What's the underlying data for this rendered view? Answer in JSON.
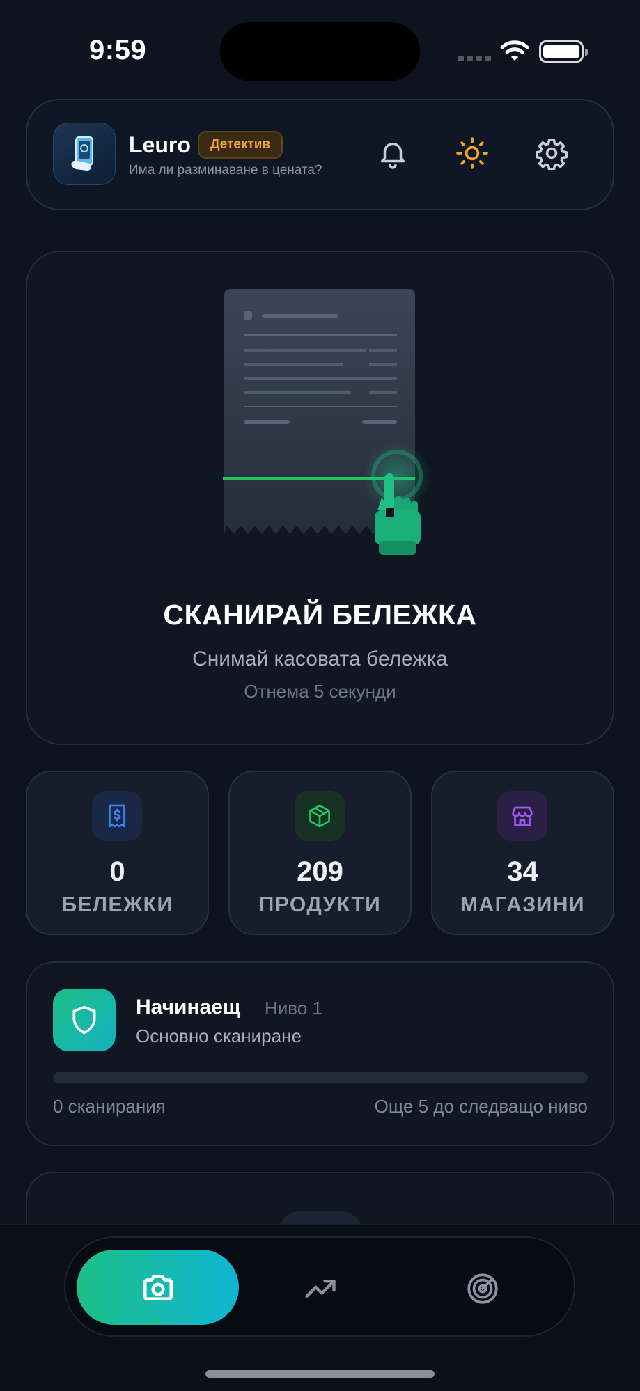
{
  "status_bar": {
    "time": "9:59"
  },
  "header": {
    "app_name": "Leuro",
    "badge": "Детектив",
    "tagline": "Има ли разминаване в цената?",
    "icons": [
      "bell-icon",
      "sun-icon",
      "gear-icon"
    ],
    "accent_sun": "#f5a524"
  },
  "scan": {
    "title": "СКАНИРАЙ БЕЛЕЖКА",
    "subtitle": "Снимай касовата бележка",
    "note": "Отнема 5 секунди"
  },
  "stats": [
    {
      "value": "0",
      "label": "БЕЛЕЖКИ",
      "icon": "receipt-icon",
      "color": "#3b82f6"
    },
    {
      "value": "209",
      "label": "ПРОДУКТИ",
      "icon": "box-icon",
      "color": "#22c55e"
    },
    {
      "value": "34",
      "label": "МАГАЗИНИ",
      "icon": "store-icon",
      "color": "#a855f7"
    }
  ],
  "level": {
    "name": "Начинаещ",
    "number_label": "Ниво 1",
    "description": "Основно сканиране",
    "scans_label": "0 сканирания",
    "next_label": "Още 5 до следващо ниво",
    "progress": 0
  },
  "nav": {
    "items": [
      "camera-icon",
      "trending-up-icon",
      "radar-icon"
    ],
    "active": 0,
    "gradient": [
      "#1cbf88",
      "#10b6d2"
    ]
  }
}
